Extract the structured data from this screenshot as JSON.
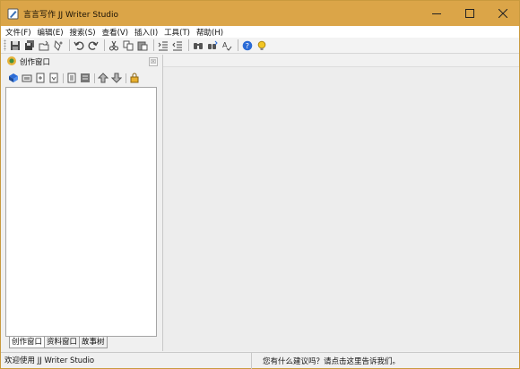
{
  "window": {
    "title": "言言写作 JJ Writer Studio",
    "title_bar_color": "#dba548",
    "controls": [
      "minimize-icon",
      "maximize-icon",
      "close-icon"
    ]
  },
  "menubar": {
    "items": [
      "文件(F)",
      "编辑(E)",
      "搜索(S)",
      "查看(V)",
      "插入(I)",
      "工具(T)",
      "帮助(H)"
    ]
  },
  "toolbar": {
    "icons": [
      "save-icon",
      "save-all-icon",
      "open-icon",
      "print-icon",
      "undo-icon",
      "redo-icon",
      "cut-icon",
      "copy-icon",
      "paste-icon",
      "indent-icon",
      "outdent-icon",
      "find-icon",
      "replace-icon",
      "spellcheck-icon",
      "help-icon",
      "tip-icon"
    ]
  },
  "left_panel": {
    "title": "创作窗口",
    "close_glyph": "☒",
    "toolbar_icons": [
      "new-book-icon",
      "open-folder-icon",
      "import-icon",
      "export-icon",
      "properties-icon",
      "rename-icon",
      "move-up-icon",
      "move-down-icon",
      "lock-icon"
    ],
    "tabs": [
      "创作窗口",
      "资料窗口",
      "故事树"
    ],
    "active_tab": 0
  },
  "statusbar": {
    "left": "欢迎使用 JJ Writer Studio",
    "right": "您有什么建议吗？请点击这里告诉我们。"
  }
}
